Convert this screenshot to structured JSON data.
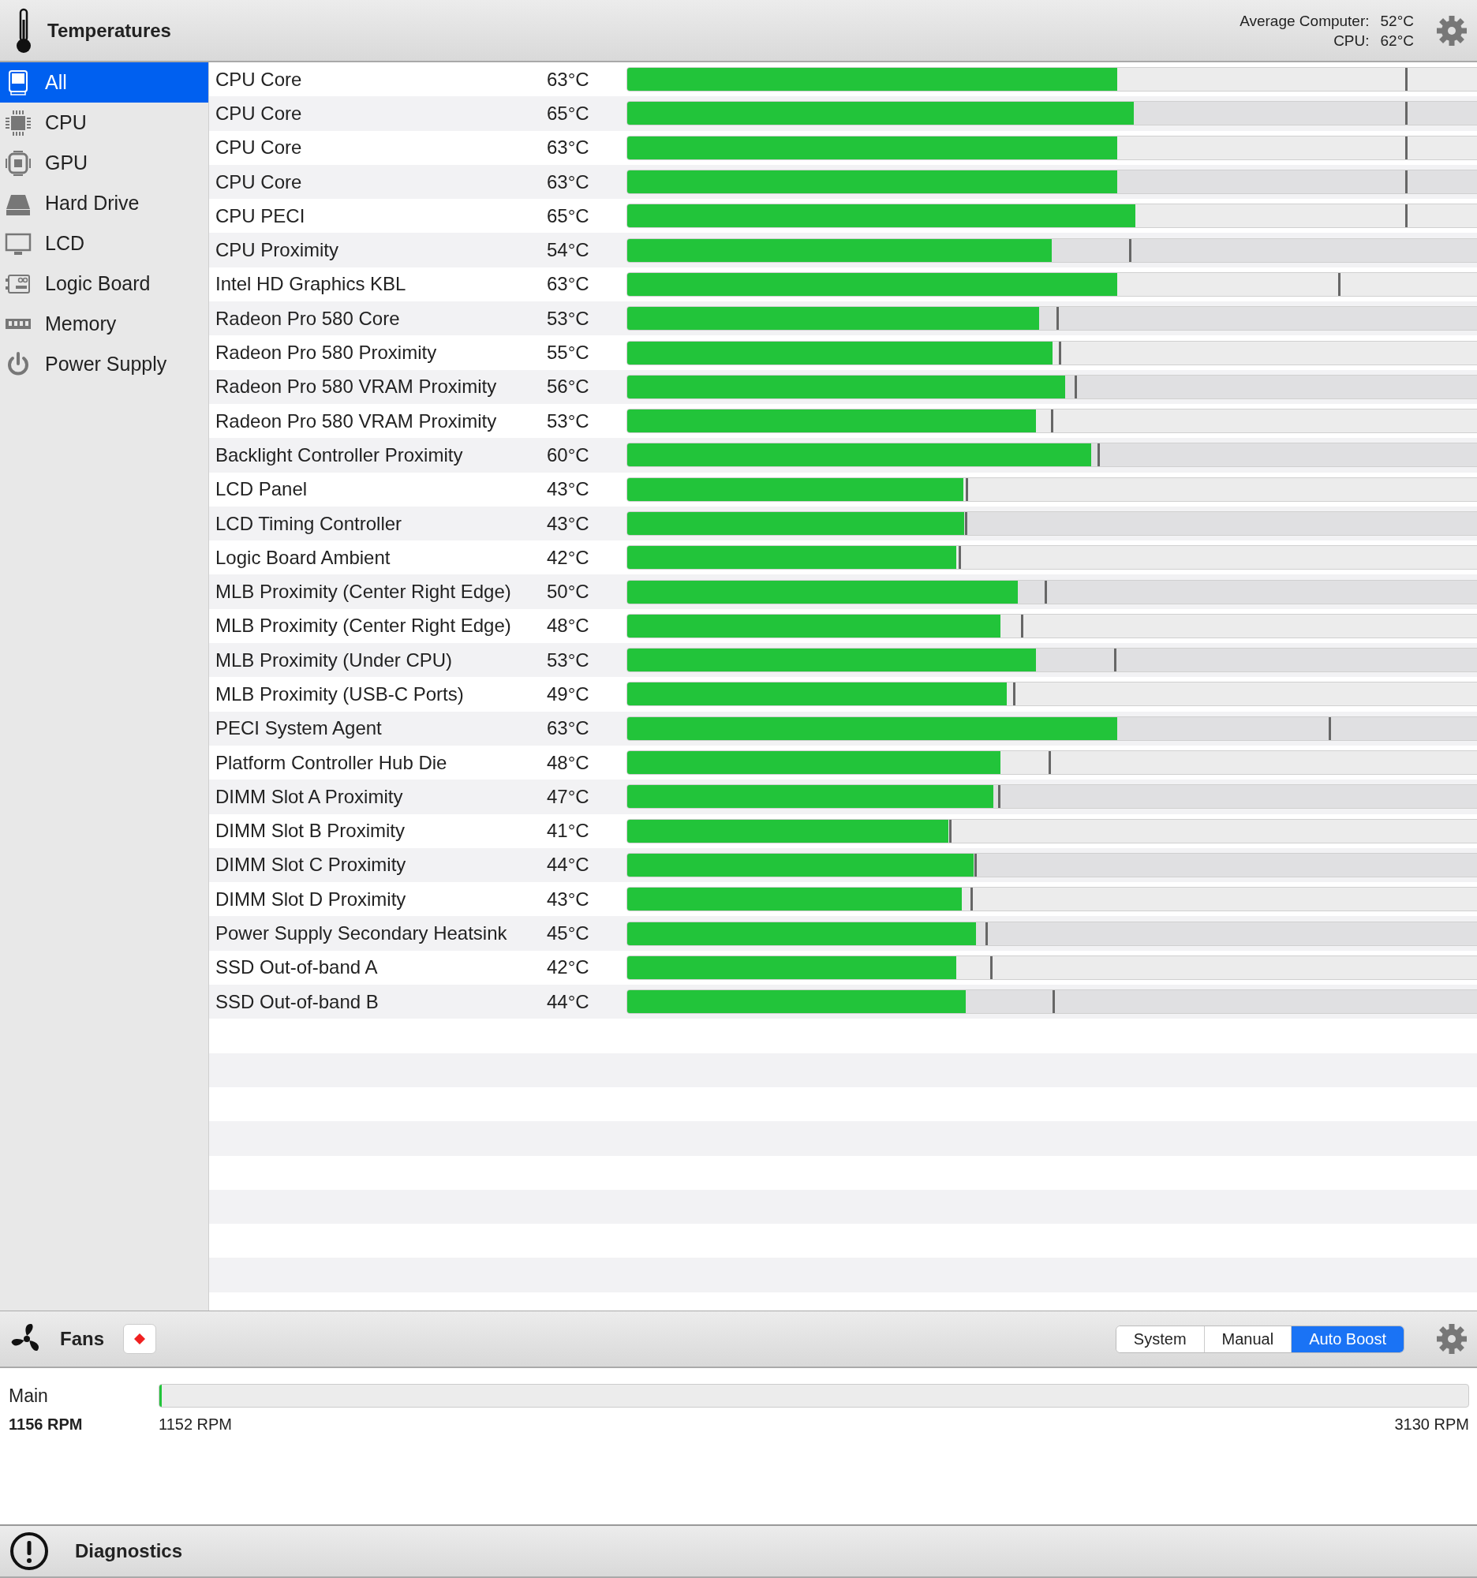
{
  "header": {
    "title": "Temperatures",
    "summary": [
      {
        "label": "Average Computer:",
        "value": "52°C"
      },
      {
        "label": "CPU:",
        "value": "62°C"
      }
    ]
  },
  "sidebar": {
    "items": [
      {
        "kind": "all",
        "label": "All",
        "selected": true
      },
      {
        "kind": "cpu",
        "label": "CPU",
        "selected": false
      },
      {
        "kind": "gpu",
        "label": "GPU",
        "selected": false
      },
      {
        "kind": "drive",
        "label": "Hard Drive",
        "selected": false
      },
      {
        "kind": "lcd",
        "label": "LCD",
        "selected": false
      },
      {
        "kind": "board",
        "label": "Logic Board",
        "selected": false
      },
      {
        "kind": "memory",
        "label": "Memory",
        "selected": false
      },
      {
        "kind": "power",
        "label": "Power Supply",
        "selected": false
      }
    ]
  },
  "sensors": [
    {
      "name": "CPU Core",
      "reading": "63°C",
      "level": 0.573,
      "threshold": {
        "level": 0.91
      }
    },
    {
      "name": "CPU Core",
      "reading": "65°C",
      "level": 0.592,
      "threshold": {
        "level": 0.91
      }
    },
    {
      "name": "CPU Core",
      "reading": "63°C",
      "level": 0.573,
      "threshold": {
        "level": 0.91
      }
    },
    {
      "name": "CPU Core",
      "reading": "63°C",
      "level": 0.573,
      "threshold": {
        "level": 0.91
      }
    },
    {
      "name": "CPU PECI",
      "reading": "65°C",
      "level": 0.594,
      "threshold": {
        "level": 0.91
      }
    },
    {
      "name": "CPU Proximity",
      "reading": "54°C",
      "level": 0.496,
      "threshold": {
        "level": 0.587
      }
    },
    {
      "name": "Intel HD Graphics KBL",
      "reading": "63°C",
      "level": 0.573,
      "threshold": {
        "level": 0.831
      }
    },
    {
      "name": "Radeon Pro 580 Core",
      "reading": "53°C",
      "level": 0.482,
      "threshold": {
        "level": 0.502
      }
    },
    {
      "name": "Radeon Pro 580 Proximity",
      "reading": "55°C",
      "level": 0.497,
      "threshold": {
        "level": 0.505
      }
    },
    {
      "name": "Radeon Pro 580 VRAM Proximity",
      "reading": "56°C",
      "level": 0.512,
      "threshold": {
        "level": 0.523
      }
    },
    {
      "name": "Radeon Pro 580 VRAM Proximity",
      "reading": "53°C",
      "level": 0.478,
      "threshold": {
        "level": 0.495
      }
    },
    {
      "name": "Backlight Controller Proximity",
      "reading": "60°C",
      "level": 0.542,
      "threshold": {
        "level": 0.55
      }
    },
    {
      "name": "LCD Panel",
      "reading": "43°C",
      "level": 0.393,
      "threshold": {
        "level": 0.396
      }
    },
    {
      "name": "LCD Timing Controller",
      "reading": "43°C",
      "level": 0.394,
      "threshold": {
        "level": 0.395
      }
    },
    {
      "name": "Logic Board Ambient",
      "reading": "42°C",
      "level": 0.385,
      "threshold": {
        "level": 0.387
      }
    },
    {
      "name": "MLB Proximity (Center Right Edge)",
      "reading": "50°C",
      "level": 0.457,
      "threshold": {
        "level": 0.488
      }
    },
    {
      "name": "MLB Proximity (Center Right Edge)",
      "reading": "48°C",
      "level": 0.436,
      "threshold": {
        "level": 0.46
      }
    },
    {
      "name": "MLB Proximity (Under CPU)",
      "reading": "53°C",
      "level": 0.478,
      "threshold": {
        "level": 0.569
      }
    },
    {
      "name": "MLB Proximity (USB-C Ports)",
      "reading": "49°C",
      "level": 0.444,
      "threshold": {
        "level": 0.451
      }
    },
    {
      "name": "PECI System Agent",
      "reading": "63°C",
      "level": 0.573,
      "threshold": {
        "level": 0.82
      }
    },
    {
      "name": "Platform Controller Hub Die",
      "reading": "48°C",
      "level": 0.436,
      "threshold": {
        "level": 0.493
      }
    },
    {
      "name": "DIMM Slot A Proximity",
      "reading": "47°C",
      "level": 0.428,
      "threshold": {
        "level": 0.434
      }
    },
    {
      "name": "DIMM Slot B Proximity",
      "reading": "41°C",
      "level": 0.375,
      "threshold": {
        "level": 0.376
      }
    },
    {
      "name": "DIMM Slot C Proximity",
      "reading": "44°C",
      "level": 0.405,
      "threshold": {
        "level": 0.406
      }
    },
    {
      "name": "DIMM Slot D Proximity",
      "reading": "43°C",
      "level": 0.391,
      "threshold": {
        "level": 0.401
      }
    },
    {
      "name": "Power Supply Secondary Heatsink",
      "reading": "45°C",
      "level": 0.408,
      "threshold": {
        "level": 0.419
      }
    },
    {
      "name": "SSD Out-of-band A",
      "reading": "42°C",
      "level": 0.385,
      "threshold": {
        "level": 0.424
      }
    },
    {
      "name": "SSD Out-of-band B",
      "reading": "44°C",
      "level": 0.396,
      "threshold": {
        "level": 0.497
      }
    }
  ],
  "fans": {
    "title": "Fans",
    "modes": [
      {
        "label": "System",
        "selected": false
      },
      {
        "label": "Manual",
        "selected": false
      },
      {
        "label": "Auto Boost",
        "selected": true
      }
    ],
    "items": [
      {
        "name": "Main",
        "current": "1156 RPM",
        "min": "1152 RPM",
        "max": "3130 RPM",
        "level": 0.002
      }
    ]
  },
  "diagnostics": {
    "title": "Diagnostics"
  }
}
